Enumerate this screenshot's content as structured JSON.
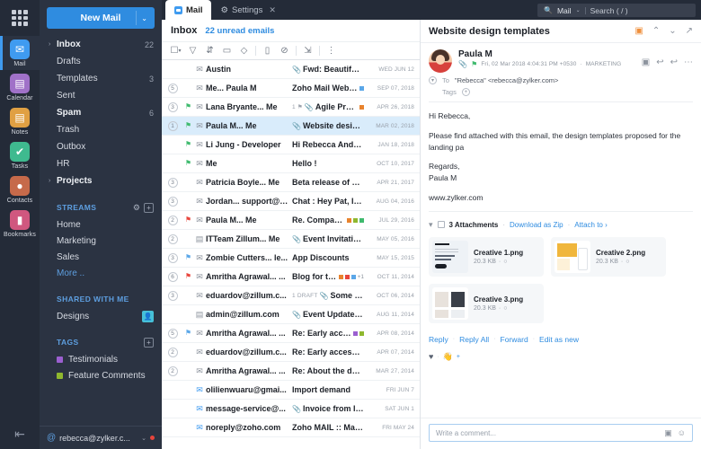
{
  "rail": {
    "apps_grid_icon": "grid-icon",
    "items": [
      {
        "label": "Mail",
        "icon": "mail-icon",
        "color": "#3f9bf0",
        "glyph": "✉",
        "active": true
      },
      {
        "label": "Calendar",
        "icon": "calendar-icon",
        "color": "#a濃",
        "glyph": "▤",
        "active": false
      },
      {
        "label": "Notes",
        "icon": "notes-icon",
        "color": "#e0a043",
        "glyph": "▤",
        "active": false
      },
      {
        "label": "Tasks",
        "icon": "tasks-icon",
        "color": "#3fba8f",
        "glyph": "✔",
        "active": false
      },
      {
        "label": "Contacts",
        "icon": "contacts-icon",
        "color": "#c66a4a",
        "glyph": "👤",
        "active": false
      },
      {
        "label": "Bookmarks",
        "icon": "bookmarks-icon",
        "color": "#d0577f",
        "glyph": "🔖",
        "active": false
      }
    ],
    "collapse_icon": "collapse-panel-icon"
  },
  "sidebar": {
    "new_mail_label": "New Mail",
    "new_mail_caret": "⌄",
    "folders": [
      {
        "name": "Inbox",
        "count": "22",
        "bold": true,
        "chevron": "›"
      },
      {
        "name": "Drafts",
        "count": "",
        "bold": false,
        "chevron": ""
      },
      {
        "name": "Templates",
        "count": "3",
        "bold": false,
        "chevron": ""
      },
      {
        "name": "Sent",
        "count": "",
        "bold": false,
        "chevron": ""
      },
      {
        "name": "Spam",
        "count": "6",
        "bold": true,
        "chevron": ""
      },
      {
        "name": "Trash",
        "count": "",
        "bold": false,
        "chevron": ""
      },
      {
        "name": "Outbox",
        "count": "",
        "bold": false,
        "chevron": ""
      },
      {
        "name": "HR",
        "count": "",
        "bold": false,
        "chevron": ""
      },
      {
        "name": "Projects",
        "count": "",
        "bold": true,
        "chevron": "›"
      }
    ],
    "streams": {
      "title": "STREAMS",
      "settings_icon": "stream-settings-icon",
      "add_icon": "+",
      "items": [
        {
          "label": "Home",
          "link": false
        },
        {
          "label": "Marketing",
          "link": false
        },
        {
          "label": "Sales",
          "link": false
        },
        {
          "label": "More ..",
          "link": true
        }
      ]
    },
    "shared": {
      "title": "SHARED WITH ME",
      "items": [
        {
          "label": "Designs",
          "avatar": "shared-user-avatar"
        }
      ]
    },
    "tags": {
      "title": "TAGS",
      "add_icon": "+",
      "items": [
        {
          "label": "Testimonials",
          "color": "#9b5fd0"
        },
        {
          "label": "Feature Comments",
          "color": "#8fb82e"
        }
      ]
    },
    "account": {
      "at_icon": "@",
      "email": "rebecca@zylker.c...",
      "caret": "⌄",
      "status_dot_color": "#e8453c"
    }
  },
  "tabbar": {
    "tabs": [
      {
        "label": "Mail",
        "icon": "mail-tab-icon",
        "active": true,
        "closable": false
      },
      {
        "label": "Settings",
        "icon": "gear-icon",
        "active": false,
        "closable": true
      }
    ],
    "close_glyph": "✕"
  },
  "search": {
    "icon": "search-icon",
    "scope": "Mail",
    "scope_caret": "⌄",
    "placeholder": "Search ( / )"
  },
  "list": {
    "title": "Inbox",
    "unread_label": "22 unread emails",
    "tools": [
      {
        "name": "select-all-checkbox",
        "glyph": "☐"
      },
      {
        "name": "filter-icon",
        "glyph": "▽"
      },
      {
        "name": "sort-icon",
        "glyph": "⇅"
      },
      {
        "name": "folder-move-icon",
        "glyph": "▭"
      },
      {
        "name": "tag-icon",
        "glyph": "◇"
      },
      {
        "name": "delete-icon",
        "glyph": "▯"
      },
      {
        "name": "spam-icon",
        "glyph": "⊘"
      },
      {
        "name": "archive-icon",
        "glyph": "⊿"
      },
      {
        "name": "more-options-icon",
        "glyph": "⋮"
      }
    ],
    "rows": [
      {
        "count": "",
        "flag": "",
        "from": "Austin",
        "draft": "",
        "clip": true,
        "subject": "Fwd: Beautiful locati...",
        "tags": [],
        "extra": "",
        "date": "WED JUN 12",
        "sel": false,
        "mark": false,
        "env": "open"
      },
      {
        "count": "5",
        "flag": "",
        "from": "Me... Paula M",
        "draft": "",
        "clip": false,
        "subject": "Zoho Mail Webinar",
        "tags": [
          "#5ba7e8"
        ],
        "extra": "",
        "date": "SEP 07, 2018",
        "sel": false,
        "mark": false,
        "env": "open"
      },
      {
        "count": "3",
        "flag": "#3fba6e",
        "from": "Lana Bryante... Me",
        "draft": "1 ⚑",
        "clip": true,
        "subject": "Agile Process",
        "tags": [
          "#e8832e"
        ],
        "extra": "",
        "date": "APR 26, 2018",
        "sel": false,
        "mark": false,
        "env": "open"
      },
      {
        "count": "1",
        "flag": "#3fba6e",
        "from": "Paula M... Me",
        "draft": "",
        "clip": true,
        "subject": "Website design temp...",
        "tags": [],
        "extra": "",
        "date": "MAR 02, 2018",
        "sel": true,
        "mark": false,
        "env": "open"
      },
      {
        "count": "",
        "flag": "#3fba6e",
        "from": "Li Jung - Developer",
        "draft": "",
        "clip": false,
        "subject": "Hi Rebecca Anderson, ...",
        "tags": [],
        "extra": "",
        "date": "JAN 18, 2018",
        "sel": false,
        "mark": false,
        "env": "open"
      },
      {
        "count": "",
        "flag": "#3fba6e",
        "from": "Me",
        "draft": "",
        "clip": false,
        "subject": "Hello !",
        "tags": [],
        "extra": "",
        "date": "OCT 10, 2017",
        "sel": false,
        "mark": false,
        "env": "open"
      },
      {
        "count": "3",
        "flag": "",
        "from": "Patricia Boyle... Me",
        "draft": "",
        "clip": false,
        "subject": "Beta release of applica...",
        "tags": [],
        "extra": "",
        "date": "APR 21, 2017",
        "sel": false,
        "mark": false,
        "env": "reply"
      },
      {
        "count": "3",
        "flag": "",
        "from": "Jordan... support@z...",
        "draft": "",
        "clip": false,
        "subject": "Chat : Hey Pat, I have f...",
        "tags": [],
        "extra": "",
        "date": "AUG 04, 2016",
        "sel": false,
        "mark": true,
        "env": "chat"
      },
      {
        "count": "2",
        "flag": "#e8453c",
        "from": "Paula M... Me",
        "draft": "",
        "clip": false,
        "subject": "Re. Comparison ...",
        "tags": [
          "#e8832e",
          "#8fb82e",
          "#3fba6e"
        ],
        "extra": "",
        "date": "JUL 29, 2016",
        "sel": false,
        "mark": false,
        "env": "chat"
      },
      {
        "count": "2",
        "flag": "",
        "from": "ITTeam Zillum... Me",
        "draft": "",
        "clip": true,
        "subject": "Event Invitation - Tea...",
        "tags": [],
        "extra": "",
        "date": "MAY 05, 2016",
        "sel": false,
        "mark": false,
        "env": "cal"
      },
      {
        "count": "3",
        "flag": "#5ba7e8",
        "from": "Zombie Cutters... le...",
        "draft": "",
        "clip": false,
        "subject": "App Discounts",
        "tags": [],
        "extra": "",
        "date": "MAY 15, 2015",
        "sel": false,
        "mark": true,
        "env": "chat"
      },
      {
        "count": "6",
        "flag": "#e8453c",
        "from": "Amritha Agrawal... ...",
        "draft": "",
        "clip": false,
        "subject": "Blog for the Be...",
        "tags": [
          "#e8832e",
          "#e8453c",
          "#5ba7e8"
        ],
        "extra": "+1",
        "date": "OCT 11, 2014",
        "sel": false,
        "mark": true,
        "env": "chat"
      },
      {
        "count": "3",
        "flag": "",
        "from": "eduardov@zillum.c...",
        "draft": "1 DRAFT",
        "clip": true,
        "subject": "Some snaps f...",
        "tags": [],
        "extra": "",
        "date": "OCT 06, 2014",
        "sel": false,
        "mark": false,
        "env": "chat"
      },
      {
        "count": "",
        "flag": "",
        "from": "admin@zillum.com",
        "draft": "",
        "clip": true,
        "subject": "Event Updated - De...",
        "tags": [],
        "extra": "",
        "date": "AUG 11, 2014",
        "sel": false,
        "mark": false,
        "env": "cal"
      },
      {
        "count": "5",
        "flag": "#5ba7e8",
        "from": "Amritha Agrawal... ...",
        "draft": "",
        "clip": false,
        "subject": "Re: Early access to ...",
        "tags": [
          "#9b5fd0",
          "#8fb82e"
        ],
        "extra": "",
        "date": "APR 08, 2014",
        "sel": false,
        "mark": true,
        "env": "chat"
      },
      {
        "count": "2",
        "flag": "",
        "from": "eduardov@zillum.c...",
        "draft": "",
        "clip": false,
        "subject": "Re: Early access to bet...",
        "tags": [],
        "extra": "",
        "date": "APR 07, 2014",
        "sel": false,
        "mark": false,
        "env": "chat"
      },
      {
        "count": "2",
        "flag": "",
        "from": "Amritha Agrawal... ...",
        "draft": "",
        "clip": false,
        "subject": "Re: About the demo pr...",
        "tags": [],
        "extra": "",
        "date": "MAR 27, 2014",
        "sel": false,
        "mark": false,
        "env": "chat"
      },
      {
        "count": "",
        "flag": "",
        "from": "olilienwuaru@gmai...",
        "draft": "",
        "clip": false,
        "subject": "Import demand",
        "tags": [],
        "extra": "",
        "date": "FRI JUN 7",
        "sel": false,
        "mark": false,
        "env": "unread"
      },
      {
        "count": "",
        "flag": "",
        "from": "message-service@...",
        "draft": "",
        "clip": true,
        "subject": "Invoice from Invoice ...",
        "tags": [],
        "extra": "",
        "date": "SAT JUN 1",
        "sel": false,
        "mark": false,
        "env": "unread"
      },
      {
        "count": "",
        "flag": "",
        "from": "noreply@zoho.com",
        "draft": "",
        "clip": false,
        "subject": "Zoho MAIL :: Mail For...",
        "tags": [],
        "extra": "",
        "date": "FRI MAY 24",
        "sel": false,
        "mark": false,
        "env": "unread"
      }
    ]
  },
  "reader": {
    "subject": "Website design templates",
    "header_icons": [
      {
        "name": "unread-toggle-icon",
        "glyph": "▣",
        "orange": true
      },
      {
        "name": "previous-message-icon",
        "glyph": "⌃",
        "orange": false
      },
      {
        "name": "next-message-icon",
        "glyph": "⌄",
        "orange": false
      },
      {
        "name": "open-in-new-window-icon",
        "glyph": "↗",
        "orange": false
      }
    ],
    "sender_name": "Paula M",
    "sender_clip_icon": "attachment-icon",
    "sender_flag_icon": "flag-icon",
    "timestamp": "Fri, 02 Mar 2018 4:04:31 PM +0530",
    "folder_label": "MARKETING",
    "message_actions": [
      {
        "name": "snooze-icon",
        "glyph": "▣"
      },
      {
        "name": "reply-icon",
        "glyph": "↩"
      },
      {
        "name": "reply-all-icon",
        "glyph": "↩"
      },
      {
        "name": "more-actions-icon",
        "glyph": "⋯"
      }
    ],
    "to_label": "To",
    "to_value": "\"Rebecca\" <rebecca@zylker.com>",
    "tags_label": "Tags",
    "tags_add_icon": "add-tag-icon",
    "body": {
      "greeting": "Hi Rebecca,",
      "paragraph": "Please find attached with this email, the design templates proposed for the landing pa",
      "signoff": "Regards,",
      "signoff_name": "Paula M",
      "website": "www.zylker.com"
    },
    "attachments": {
      "count_label": "3 Attachments",
      "download_zip": "Download as Zip",
      "attach_to": "Attach to ›",
      "items": [
        {
          "name": "Creative 1.png",
          "size": "20.3 KB",
          "thumb": "t1"
        },
        {
          "name": "Creative 2.png",
          "size": "20.3 KB",
          "thumb": "t2"
        },
        {
          "name": "Creative 3.png",
          "size": "20.3 KB",
          "thumb": "t3"
        }
      ]
    },
    "reply_actions": [
      {
        "label": "Reply"
      },
      {
        "label": "Reply All"
      },
      {
        "label": "Forward"
      },
      {
        "label": "Edit as new"
      }
    ],
    "reactions": [
      {
        "name": "heart-reaction-icon",
        "glyph": "♥"
      },
      {
        "name": "wave-reaction-icon",
        "glyph": "👋"
      }
    ],
    "add_reaction_icon": "+",
    "comment_placeholder": "Write a comment...",
    "comment_icons": [
      {
        "name": "attach-file-icon",
        "glyph": "▣"
      },
      {
        "name": "emoji-icon",
        "glyph": "☺"
      }
    ]
  }
}
